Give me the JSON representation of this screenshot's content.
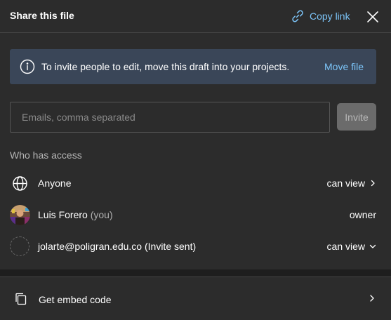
{
  "header": {
    "title": "Share this file",
    "copy_link_label": "Copy link",
    "copy_link_icon": "link-icon",
    "close_icon": "close-icon"
  },
  "banner": {
    "icon": "info-icon",
    "text": "To invite people to edit, move this draft into your projects.",
    "action_label": "Move file"
  },
  "invite": {
    "placeholder": "Emails, comma separated",
    "value": "",
    "button_label": "Invite"
  },
  "access": {
    "heading": "Who has access",
    "rows": [
      {
        "icon": "globe-icon",
        "name": "Anyone",
        "suffix": "",
        "permission": "can view",
        "permission_icon": "chevron-right-icon"
      },
      {
        "icon": "avatar",
        "name": "Luis Forero",
        "suffix": "(you)",
        "permission": "owner",
        "permission_icon": ""
      },
      {
        "icon": "pending-avatar",
        "name": "jolarte@poligran.edu.co",
        "suffix": "(Invite sent)",
        "permission": "can view",
        "permission_icon": "chevron-down-icon"
      }
    ]
  },
  "embed": {
    "icon": "embed-code-icon",
    "label": "Get embed code",
    "chevron_icon": "chevron-right-icon"
  },
  "colors": {
    "background": "#2c2c2c",
    "accent_link": "#7cc4f8",
    "banner_bg": "#3a4658",
    "invite_button_bg": "#6b6b6b",
    "muted_text": "#b5b5b5"
  }
}
